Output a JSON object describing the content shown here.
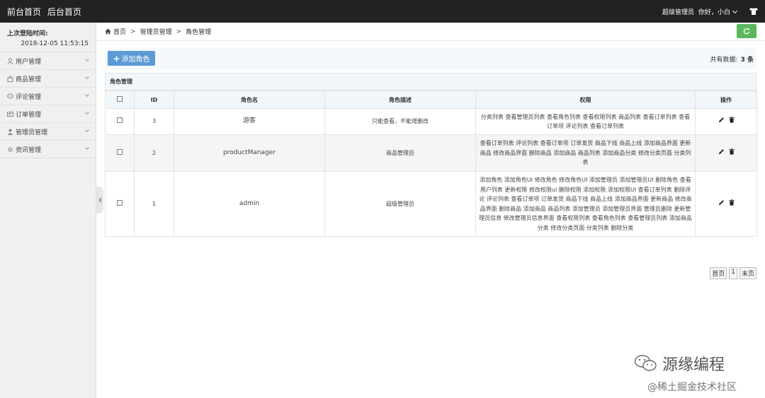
{
  "topbar": {
    "nav_front": "前台首页",
    "nav_back": "后台首页",
    "role": "超级管理员",
    "greeting": "你好，小白",
    "shirt_icon": "tshirt-icon"
  },
  "sidebar": {
    "login_label": "上次登陆时间:",
    "login_time": "2018-12-05 11:53:15",
    "items": [
      {
        "label": "用户管理",
        "icon": "user-icon"
      },
      {
        "label": "商品管理",
        "icon": "bag-icon"
      },
      {
        "label": "评论管理",
        "icon": "comment-icon"
      },
      {
        "label": "订单管理",
        "icon": "order-icon"
      },
      {
        "label": "管理员管理",
        "icon": "admin-icon"
      },
      {
        "label": "资讯管理",
        "icon": "gear-icon"
      }
    ]
  },
  "breadcrumb": {
    "home": "首页",
    "level1": "管理员管理",
    "level2": "角色管理"
  },
  "toolbar": {
    "add_label": "添加角色",
    "total_label": "共有数据:",
    "total_count": "3 条"
  },
  "panel_title": "角色管理",
  "table": {
    "headers": [
      "",
      "ID",
      "角色名",
      "角色描述",
      "权限",
      "操作"
    ],
    "rows": [
      {
        "id": "3",
        "name": "游客",
        "desc": "只能查看，不能增删改",
        "perms": "分类列表 查看管理员列表 查看角色列表 查看权限列表 商品列表 查看订单列表 查看订单项 评论列表 查看订单列表"
      },
      {
        "id": "2",
        "name": "productManager",
        "desc": "商品管理员",
        "perms": "查看订单列表 评论列表 查看订单项 订单发货 商品下线 商品上线 添加商品界面 更新商品 修改商品界面 删除商品 添加商品 商品列表 添加商品分类 修改分类页面 分类列表"
      },
      {
        "id": "1",
        "name": "admin",
        "desc": "超级管理员",
        "perms": "添加角色 添加角色UI 修改角色 修改角色UI 添加管理员 添加管理员UI 删除角色 查看用户列表 更新权限 修改权限ui 删除权限 添加权限 添加权限UI 查看订单列表 删除评论 评论列表 查看订单项 订单发货 商品下线 商品上线 添加商品界面 更新商品 修改商品界面 删除商品 添加商品 商品列表 添加管理员 添加管理员界面 管理员删除 更新管理员信息 修改管理员信息界面 查看权限列表 查看角色列表 查看管理员列表 添加商品分类 修改分类页面 分类列表 删除分类"
      }
    ]
  },
  "pager": {
    "first": "首页",
    "page": "1",
    "last": "末页"
  },
  "watermark": {
    "brand": "源缘编程",
    "site": "@稀土掘金技术社区"
  }
}
